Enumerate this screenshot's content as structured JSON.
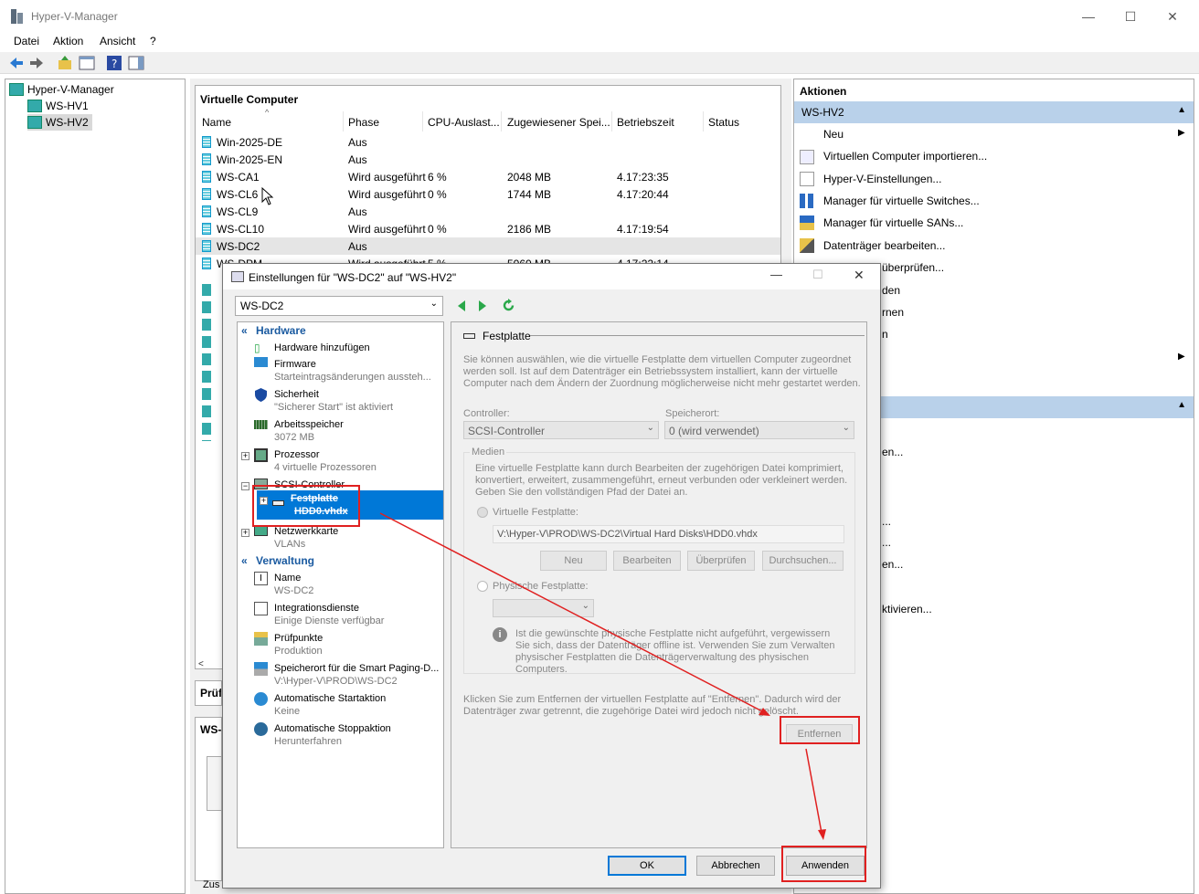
{
  "window": {
    "title": "Hyper-V-Manager"
  },
  "menu": [
    "Datei",
    "Aktion",
    "Ansicht",
    "?"
  ],
  "tree": {
    "root": "Hyper-V-Manager",
    "servers": [
      "WS-HV1",
      "WS-HV2"
    ]
  },
  "vm_panel": {
    "title": "Virtuelle Computer",
    "columns": [
      "Name",
      "Phase",
      "CPU-Auslast...",
      "Zugewiesener Spei...",
      "Betriebszeit",
      "Status"
    ],
    "rows": [
      {
        "name": "Win-2025-DE",
        "phase": "Aus",
        "cpu": "",
        "mem": "",
        "uptime": ""
      },
      {
        "name": "Win-2025-EN",
        "phase": "Aus",
        "cpu": "",
        "mem": "",
        "uptime": ""
      },
      {
        "name": "WS-CA1",
        "phase": "Wird ausgeführt",
        "cpu": "6 %",
        "mem": "2048 MB",
        "uptime": "4.17:23:35"
      },
      {
        "name": "WS-CL6",
        "phase": "Wird ausgeführt",
        "cpu": "0 %",
        "mem": "1744 MB",
        "uptime": "4.17:20:44"
      },
      {
        "name": "WS-CL9",
        "phase": "Aus",
        "cpu": "",
        "mem": "",
        "uptime": ""
      },
      {
        "name": "WS-CL10",
        "phase": "Wird ausgeführt",
        "cpu": "0 %",
        "mem": "2186 MB",
        "uptime": "4.17:19:54"
      },
      {
        "name": "WS-DC2",
        "phase": "Aus",
        "cpu": "",
        "mem": "",
        "uptime": ""
      },
      {
        "name": "WS-DPM",
        "phase": "Wird ausgeführt",
        "cpu": "5 %",
        "mem": "5060 MB",
        "uptime": "4.17:22:14"
      }
    ],
    "partial_labels": [
      "Prüf",
      "WS-",
      "Zus"
    ]
  },
  "actions": {
    "title": "Aktionen",
    "group": "WS-HV2",
    "items": [
      "Neu",
      "Virtuellen Computer importieren...",
      "Hyper-V-Einstellungen...",
      "Manager für virtuelle Switches...",
      "Manager für virtuelle SANs...",
      "Datenträger bearbeiten...",
      "überprüfen...",
      "den",
      "rnen",
      "n"
    ],
    "partial_items": [
      "en...",
      "...",
      "...",
      "en...",
      "ktivieren..."
    ]
  },
  "dialog": {
    "title": "Einstellungen für \"WS-DC2\" auf \"WS-HV2\"",
    "vm": "WS-DC2",
    "hardware_label": "Hardware",
    "management_label": "Verwaltung",
    "hardware": [
      {
        "label": "Hardware hinzufügen",
        "sub": ""
      },
      {
        "label": "Firmware",
        "sub": "Starteintragsänderungen aussteh..."
      },
      {
        "label": "Sicherheit",
        "sub": "\"Sicherer Start\" ist aktiviert"
      },
      {
        "label": "Arbeitsspeicher",
        "sub": "3072 MB"
      },
      {
        "label": "Prozessor",
        "sub": "4 virtuelle Prozessoren"
      },
      {
        "label": "SCSI-Controller",
        "sub": ""
      },
      {
        "label": "Festplatte",
        "sub": "HDD0.vhdx"
      },
      {
        "label": "Netzwerkkarte",
        "sub": "VLANs"
      }
    ],
    "management": [
      {
        "label": "Name",
        "sub": "WS-DC2"
      },
      {
        "label": "Integrationsdienste",
        "sub": "Einige Dienste verfügbar"
      },
      {
        "label": "Prüfpunkte",
        "sub": "Produktion"
      },
      {
        "label": "Speicherort für die Smart Paging-D...",
        "sub": "V:\\Hyper-V\\PROD\\WS-DC2"
      },
      {
        "label": "Automatische Startaktion",
        "sub": "Keine"
      },
      {
        "label": "Automatische Stoppaktion",
        "sub": "Herunterfahren"
      }
    ],
    "pane": {
      "title": "Festplatte",
      "intro": "Sie können auswählen, wie die virtuelle Festplatte dem virtuellen Computer zugeordnet werden soll. Ist auf dem Datenträger ein Betriebssystem installiert, kann der virtuelle Computer nach dem Ändern der Zuordnung möglicherweise nicht mehr gestartet werden.",
      "controller_label": "Controller:",
      "controller_value": "SCSI-Controller",
      "location_label": "Speicherort:",
      "location_value": "0 (wird verwendet)",
      "media_label": "Medien",
      "media_text": "Eine virtuelle Festplatte kann durch Bearbeiten der zugehörigen Datei komprimiert, konvertiert, erweitert, zusammengeführt, erneut verbunden oder verkleinert werden. Geben Sie den vollständigen Pfad der Datei an.",
      "vhd_label": "Virtuelle Festplatte:",
      "vhd_path": "V:\\Hyper-V\\PROD\\WS-DC2\\Virtual Hard Disks\\HDD0.vhdx",
      "btn_new": "Neu",
      "btn_edit": "Bearbeiten",
      "btn_check": "Überprüfen",
      "btn_browse": "Durchsuchen...",
      "phys_label": "Physische Festplatte:",
      "phys_info": "Ist die gewünschte physische Festplatte nicht aufgeführt, vergewissern Sie sich, dass der Datenträger offline ist. Verwenden Sie zum Verwalten physischer Festplatten die Datenträgerverwaltung des physischen Computers.",
      "remove_text": "Klicken Sie zum Entfernen der virtuellen Festplatte auf \"Entfernen\". Dadurch wird der Datenträger zwar getrennt, die zugehörige Datei wird jedoch nicht gelöscht.",
      "btn_remove": "Entfernen"
    },
    "ok": "OK",
    "cancel": "Abbrechen",
    "apply": "Anwenden"
  },
  "colors": {
    "selection": "#0078d7",
    "annotation": "#e02020",
    "section": "#1a5aa0"
  }
}
